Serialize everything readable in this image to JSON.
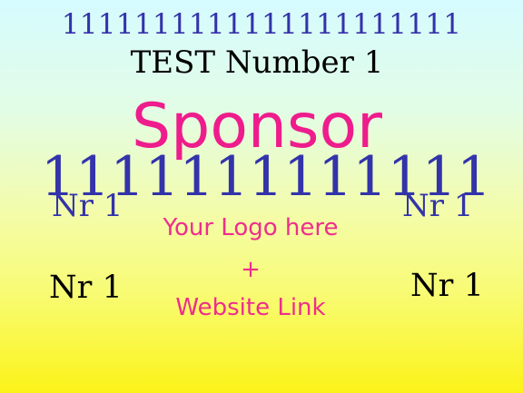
{
  "banner": {
    "top_number": "1111111111111111111111",
    "title": "TEST Number 1",
    "sponsor": "Sponsor",
    "big_number": "1111111111111",
    "nr_top_left": "Nr 1",
    "nr_top_right": "Nr 1",
    "logo_text": "Your Logo here",
    "plus": "+",
    "website_text": "Website Link",
    "nr_bottom_left": "Nr 1",
    "nr_bottom_right": "Nr 1"
  },
  "colors": {
    "blue_text": "#3333aa",
    "pink_text": "#ee1c8c",
    "black_text": "#000000",
    "gradient_top": "#d6fbff",
    "gradient_bottom": "#fbf318"
  }
}
